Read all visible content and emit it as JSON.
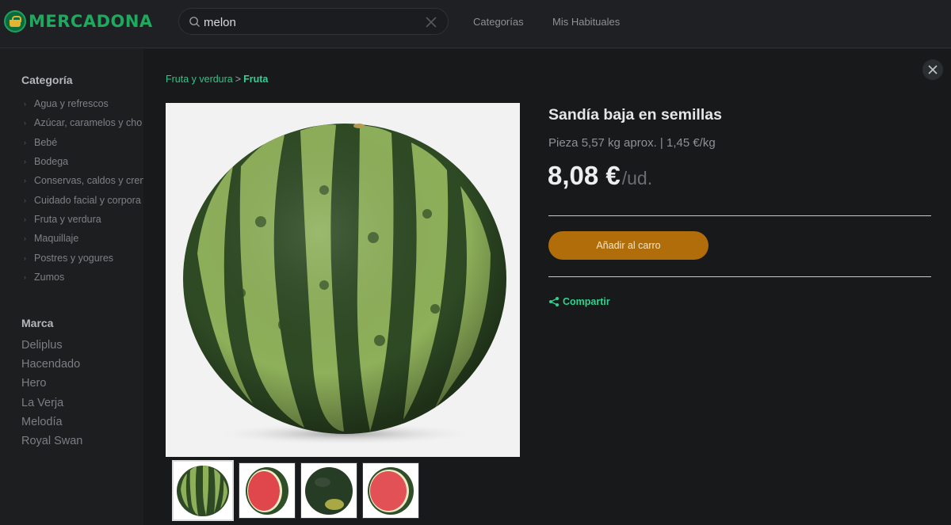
{
  "header": {
    "brand": "MERCADONA",
    "search": {
      "value": "melon",
      "placeholder": ""
    },
    "nav": {
      "categories": "Categorías",
      "favourites": "Mis Habituales"
    }
  },
  "sidebar": {
    "category_title": "Categoría",
    "categories": [
      "Agua y refrescos",
      "Azúcar, caramelos y cho",
      "Bebé",
      "Bodega",
      "Conservas, caldos y crem",
      "Cuidado facial y corpora",
      "Fruta y verdura",
      "Maquillaje",
      "Postres y yogures",
      "Zumos"
    ],
    "brand_title": "Marca",
    "brands": [
      "Deliplus",
      "Hacendado",
      "Hero",
      "La Verja",
      "Melodía",
      "Royal Swan"
    ]
  },
  "product": {
    "breadcrumb": {
      "parent": "Fruta y verdura",
      "separator": ">",
      "current": "Fruta"
    },
    "title": "Sandía baja en semillas",
    "subtitle": "Pieza 5,57 kg aprox. | 1,45 €/kg",
    "price": "8,08 €",
    "price_unit": "/ud.",
    "add_to_cart": "Añadir al carro",
    "share": "Compartir"
  },
  "colors": {
    "accent_green": "#2fd38f",
    "button_gold": "#b06d09",
    "watermelon_dark": "#2e4a24",
    "watermelon_light": "#8eb05a",
    "watermelon_flesh": "#e0474c"
  }
}
